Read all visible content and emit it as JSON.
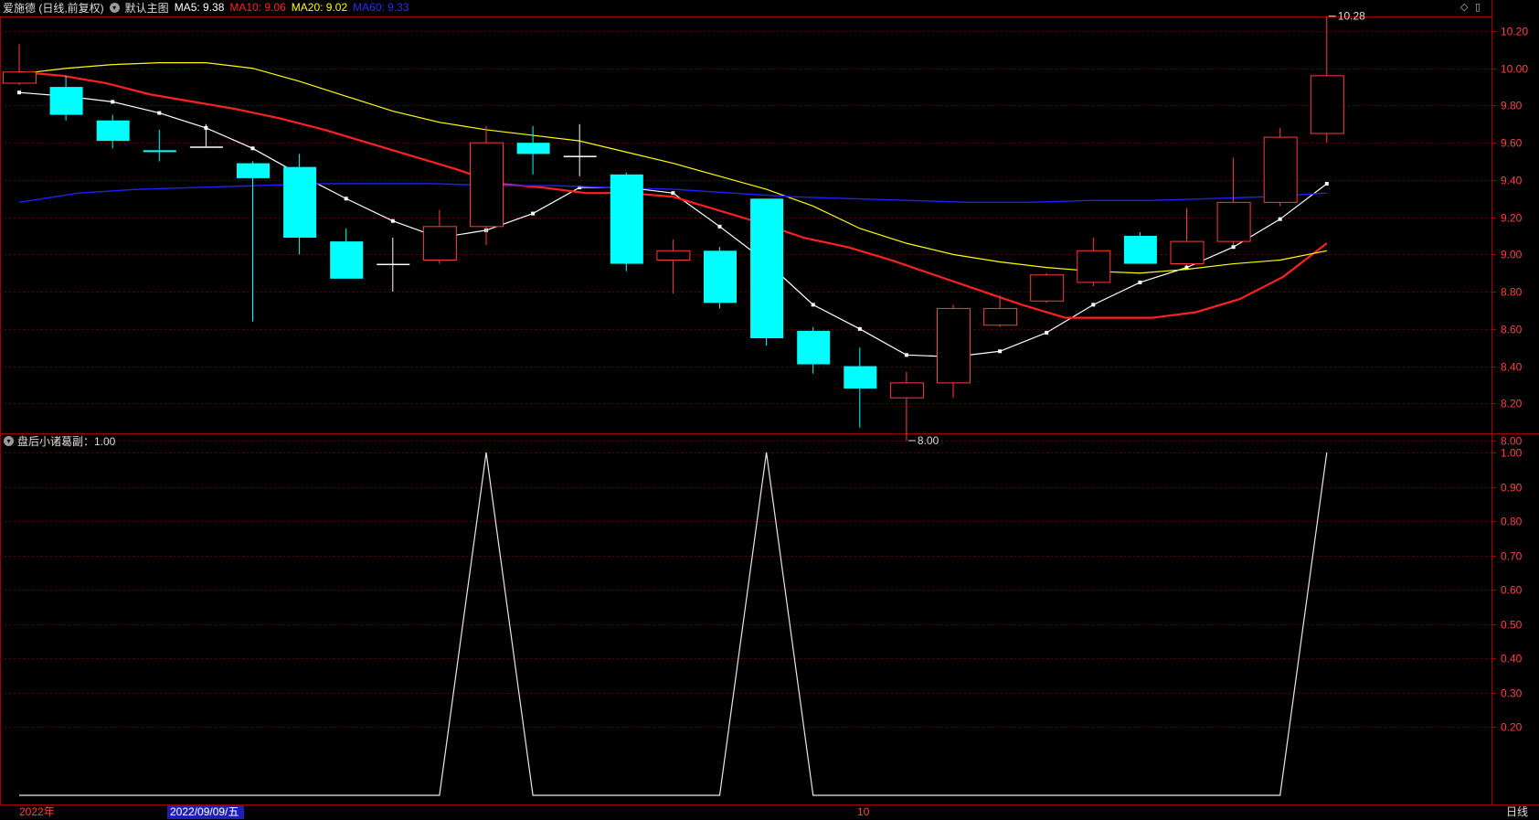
{
  "header": {
    "stock_label": "爱施德 (日线,前复权)",
    "template_label": "默认主图",
    "ma5_label": "MA5: 9.38",
    "ma10_label": "MA10: 9.06",
    "ma20_label": "MA20: 9.02",
    "ma60_label": "MA60: 9.33"
  },
  "subchart": {
    "label": "盘后小诸葛副：1.00"
  },
  "footer": {
    "year_label": "2022年",
    "cursor_date": "2022/09/09/五",
    "month_label": "10",
    "period_button": "日线"
  },
  "colors": {
    "up": "#ff3b3b",
    "down": "#00ffff",
    "ma5": "#ffffff",
    "ma10": "#ff2020",
    "ma20": "#ffff00",
    "ma60": "#2020ff",
    "axis": "#a00000",
    "grid": "#5a0000"
  },
  "icons": [
    "collapse-toggle-icon",
    "diamond-icon",
    "panel-toggle-icon"
  ],
  "chart_data": [
    {
      "type": "candlestick",
      "title": "爱施德 (日线,前复权)",
      "ylim": [
        7.9,
        10.35
      ],
      "y_ticks": [
        "10.20",
        "10.00",
        "9.80",
        "9.60",
        "9.40",
        "9.20",
        "9.00",
        "8.80",
        "8.60",
        "8.40",
        "8.20",
        "8.00"
      ],
      "annotations": [
        {
          "text": "10.28",
          "price": 10.28,
          "candle": 28
        },
        {
          "text": "8.00",
          "price": 8.0,
          "candle": 19
        }
      ],
      "candles": [
        {
          "o": 9.92,
          "h": 10.13,
          "l": 9.91,
          "c": 9.98
        },
        {
          "o": 9.9,
          "h": 9.96,
          "l": 9.72,
          "c": 9.75
        },
        {
          "o": 9.72,
          "h": 9.75,
          "l": 9.57,
          "c": 9.61
        },
        {
          "o": 9.56,
          "h": 9.67,
          "l": 9.5,
          "c": 9.55
        },
        {
          "o": 9.58,
          "h": 9.7,
          "l": 9.58,
          "c": 9.58
        },
        {
          "o": 9.49,
          "h": 9.5,
          "l": 8.64,
          "c": 9.41
        },
        {
          "o": 9.47,
          "h": 9.54,
          "l": 9.0,
          "c": 9.09
        },
        {
          "o": 9.07,
          "h": 9.14,
          "l": 8.87,
          "c": 8.87
        },
        {
          "o": 8.95,
          "h": 9.09,
          "l": 8.8,
          "c": 8.95
        },
        {
          "o": 8.97,
          "h": 9.24,
          "l": 8.95,
          "c": 9.15
        },
        {
          "o": 9.15,
          "h": 9.69,
          "l": 9.05,
          "c": 9.6
        },
        {
          "o": 9.6,
          "h": 9.69,
          "l": 9.43,
          "c": 9.54
        },
        {
          "o": 9.53,
          "h": 9.7,
          "l": 9.42,
          "c": 9.53
        },
        {
          "o": 9.43,
          "h": 9.44,
          "l": 8.91,
          "c": 8.95
        },
        {
          "o": 8.97,
          "h": 9.08,
          "l": 8.79,
          "c": 9.02
        },
        {
          "o": 9.02,
          "h": 9.04,
          "l": 8.71,
          "c": 8.74
        },
        {
          "o": 9.3,
          "h": 9.3,
          "l": 8.51,
          "c": 8.55
        },
        {
          "o": 8.59,
          "h": 8.61,
          "l": 8.36,
          "c": 8.41
        },
        {
          "o": 8.4,
          "h": 8.5,
          "l": 8.07,
          "c": 8.28
        },
        {
          "o": 8.23,
          "h": 8.37,
          "l": 8.0,
          "c": 8.31
        },
        {
          "o": 8.31,
          "h": 8.73,
          "l": 8.23,
          "c": 8.71
        },
        {
          "o": 8.62,
          "h": 8.78,
          "l": 8.61,
          "c": 8.71
        },
        {
          "o": 8.75,
          "h": 8.9,
          "l": 8.74,
          "c": 8.89
        },
        {
          "o": 8.85,
          "h": 9.09,
          "l": 8.83,
          "c": 9.02
        },
        {
          "o": 9.1,
          "h": 9.12,
          "l": 8.95,
          "c": 8.95
        },
        {
          "o": 8.95,
          "h": 9.25,
          "l": 8.94,
          "c": 9.07
        },
        {
          "o": 9.07,
          "h": 9.52,
          "l": 9.05,
          "c": 9.28
        },
        {
          "o": 9.28,
          "h": 9.68,
          "l": 9.26,
          "c": 9.63
        },
        {
          "o": 9.65,
          "h": 10.28,
          "l": 9.6,
          "c": 9.96
        }
      ],
      "series": [
        {
          "name": "MA5",
          "values": [
            9.87,
            9.85,
            9.82,
            9.76,
            9.68,
            9.57,
            9.43,
            9.3,
            9.18,
            9.09,
            9.13,
            9.22,
            9.36,
            9.36,
            9.33,
            9.15,
            8.96,
            8.73,
            8.6,
            8.46,
            8.45,
            8.48,
            8.58,
            8.73,
            8.85,
            8.93,
            9.04,
            9.19,
            9.38
          ]
        },
        {
          "name": "MA10",
          "values": [
            9.98,
            9.96,
            9.92,
            9.86,
            9.82,
            9.78,
            9.73,
            9.67,
            9.6,
            9.53,
            9.46,
            9.38,
            9.36,
            9.33,
            9.33,
            9.31,
            9.24,
            9.17,
            9.09,
            9.04,
            8.97,
            8.89,
            8.81,
            8.73,
            8.66,
            8.66,
            8.66,
            8.69,
            8.76,
            8.88,
            9.06
          ]
        },
        {
          "name": "MA20",
          "values": [
            9.97,
            10.0,
            10.02,
            10.03,
            10.03,
            10.0,
            9.93,
            9.85,
            9.77,
            9.71,
            9.67,
            9.64,
            9.61,
            9.55,
            9.49,
            9.42,
            9.35,
            9.26,
            9.14,
            9.06,
            9.0,
            8.96,
            8.93,
            8.91,
            8.9,
            8.92,
            8.95,
            8.97,
            9.02
          ]
        },
        {
          "name": "MA60",
          "values": [
            9.28,
            9.33,
            9.35,
            9.36,
            9.37,
            9.38,
            9.38,
            9.38,
            9.37,
            9.37,
            9.36,
            9.35,
            9.33,
            9.31,
            9.3,
            9.29,
            9.28,
            9.28,
            9.29,
            9.29,
            9.3,
            9.31,
            9.33
          ]
        }
      ]
    },
    {
      "type": "line",
      "title": "盘后小诸葛副",
      "ylim": [
        0,
        1.03
      ],
      "y_ticks": [
        "1.00",
        "0.90",
        "0.80",
        "0.70",
        "0.60",
        "0.50",
        "0.40",
        "0.30",
        "0.20"
      ],
      "series": [
        {
          "name": "盘后小诸葛副",
          "values": [
            0,
            0,
            0,
            0,
            0,
            0,
            0,
            0,
            0,
            0,
            1,
            0,
            0,
            0,
            0,
            0,
            1,
            0,
            0,
            0,
            0,
            0,
            0,
            0,
            0,
            0,
            0,
            0,
            1
          ]
        }
      ]
    }
  ]
}
